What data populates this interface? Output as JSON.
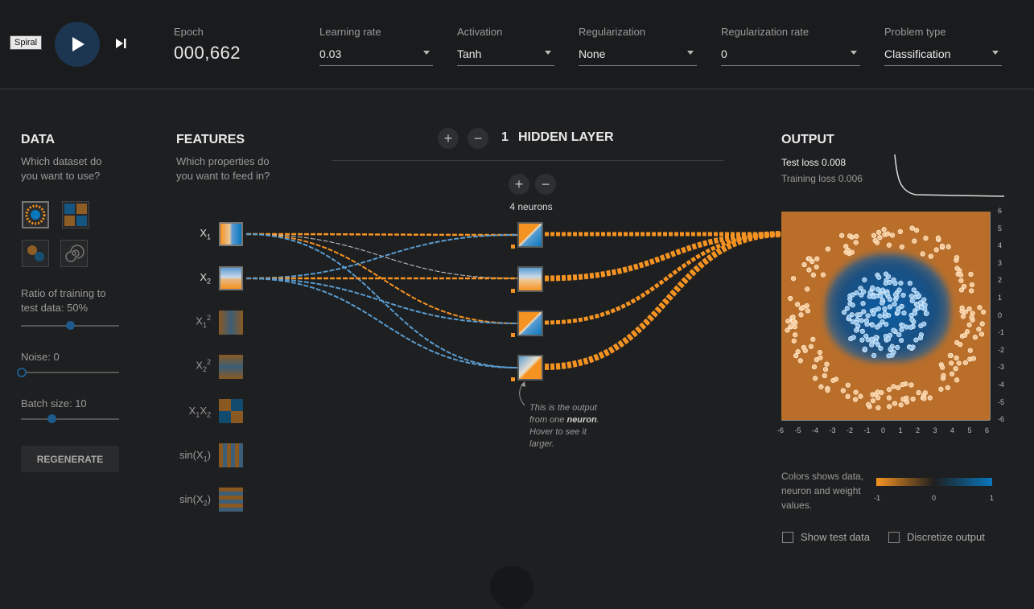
{
  "tooltip": "Spiral",
  "controls": {
    "epoch_label": "Epoch",
    "epoch_value": "000,662",
    "learning_rate_label": "Learning rate",
    "learning_rate_value": "0.03",
    "activation_label": "Activation",
    "activation_value": "Tanh",
    "regularization_label": "Regularization",
    "regularization_value": "None",
    "regularization_rate_label": "Regularization rate",
    "regularization_rate_value": "0",
    "problem_type_label": "Problem type",
    "problem_type_value": "Classification"
  },
  "data_panel": {
    "title": "DATA",
    "question": "Which dataset do you want to use?",
    "ratio_label": "Ratio of training to test data:  50%",
    "ratio_value": 50,
    "noise_label": "Noise:  0",
    "noise_value": 0,
    "batch_label": "Batch size:  10",
    "batch_value": 10,
    "regenerate_label": "REGENERATE"
  },
  "features_panel": {
    "title": "FEATURES",
    "question": "Which properties do you want to feed in?",
    "features": [
      "X1",
      "X2",
      "X1²",
      "X2²",
      "X1X2",
      "sin(X1)",
      "sin(X2)"
    ]
  },
  "hidden": {
    "count": "1",
    "label": "HIDDEN LAYER",
    "neurons_label": "4 neurons",
    "annotation_pre": "This is the output from one ",
    "annotation_bold": "neuron",
    "annotation_post": ". Hover to see it larger."
  },
  "output": {
    "title": "OUTPUT",
    "test_loss": "Test loss 0.008",
    "training_loss": "Training loss 0.006",
    "y_ticks": [
      "6",
      "5",
      "4",
      "3",
      "2",
      "1",
      "0",
      "-1",
      "-2",
      "-3",
      "-4",
      "-5",
      "-6"
    ],
    "x_ticks": [
      "-6",
      "-5",
      "-4",
      "-3",
      "-2",
      "-1",
      "0",
      "1",
      "2",
      "3",
      "4",
      "5",
      "6"
    ],
    "legend_text": "Colors shows data, neuron and weight values.",
    "legend_ticks": [
      "-1",
      "0",
      "1"
    ],
    "show_test_label": "Show test data",
    "discretize_label": "Discretize output"
  },
  "colors": {
    "orange": "#f59322",
    "blue": "#0877bd",
    "background": "#1e1f20"
  }
}
